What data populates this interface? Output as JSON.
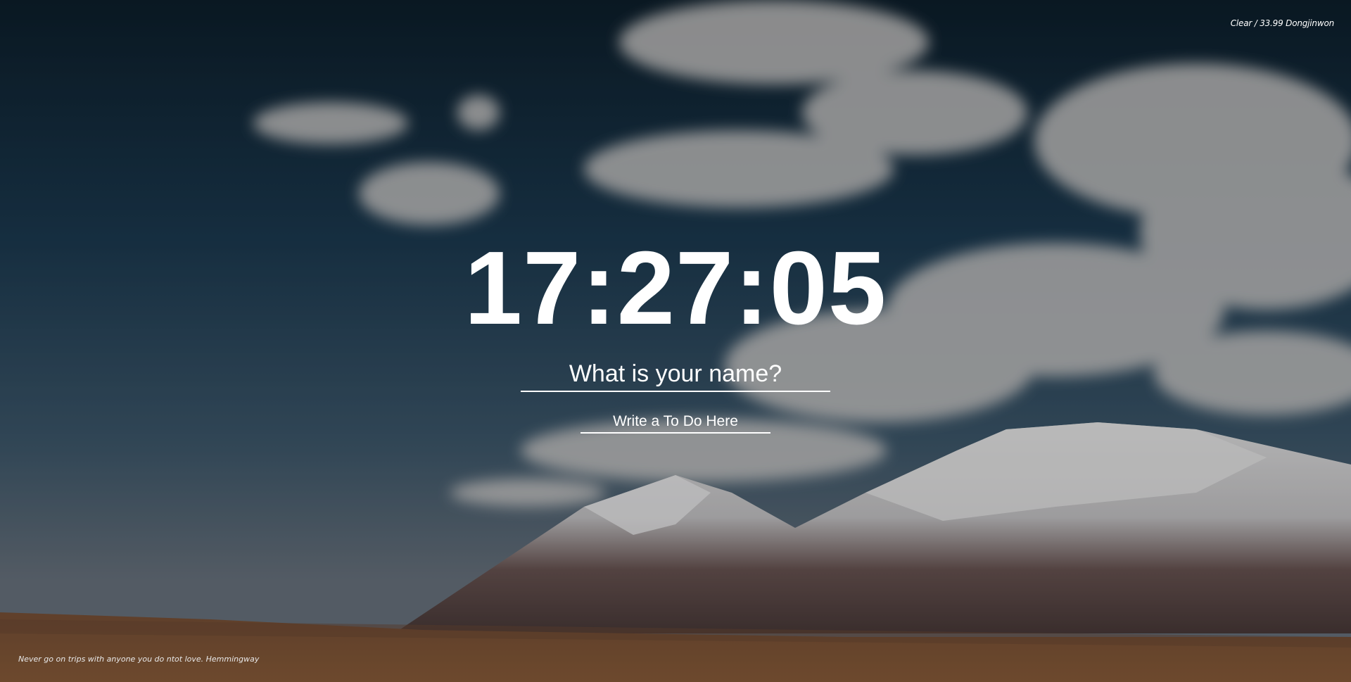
{
  "weather": {
    "text": "Clear / 33.99 Dongjinwon"
  },
  "clock": {
    "time": "17:27:05"
  },
  "name_form": {
    "placeholder": "What is your name?"
  },
  "todo_form": {
    "placeholder": "Write a To Do Here"
  },
  "quote": {
    "text": "Never go on trips with anyone you do ntot love. Hemmingway"
  },
  "colors": {
    "sky_top": "#0f2433",
    "sky_mid": "#2b4a60",
    "sky_low": "#5f6f7a",
    "cloud": "#d8d6d4",
    "snow": "#e9e9ea",
    "rock": "#5a4a48",
    "desert": "#8a5d3c",
    "text": "#ffffff"
  }
}
